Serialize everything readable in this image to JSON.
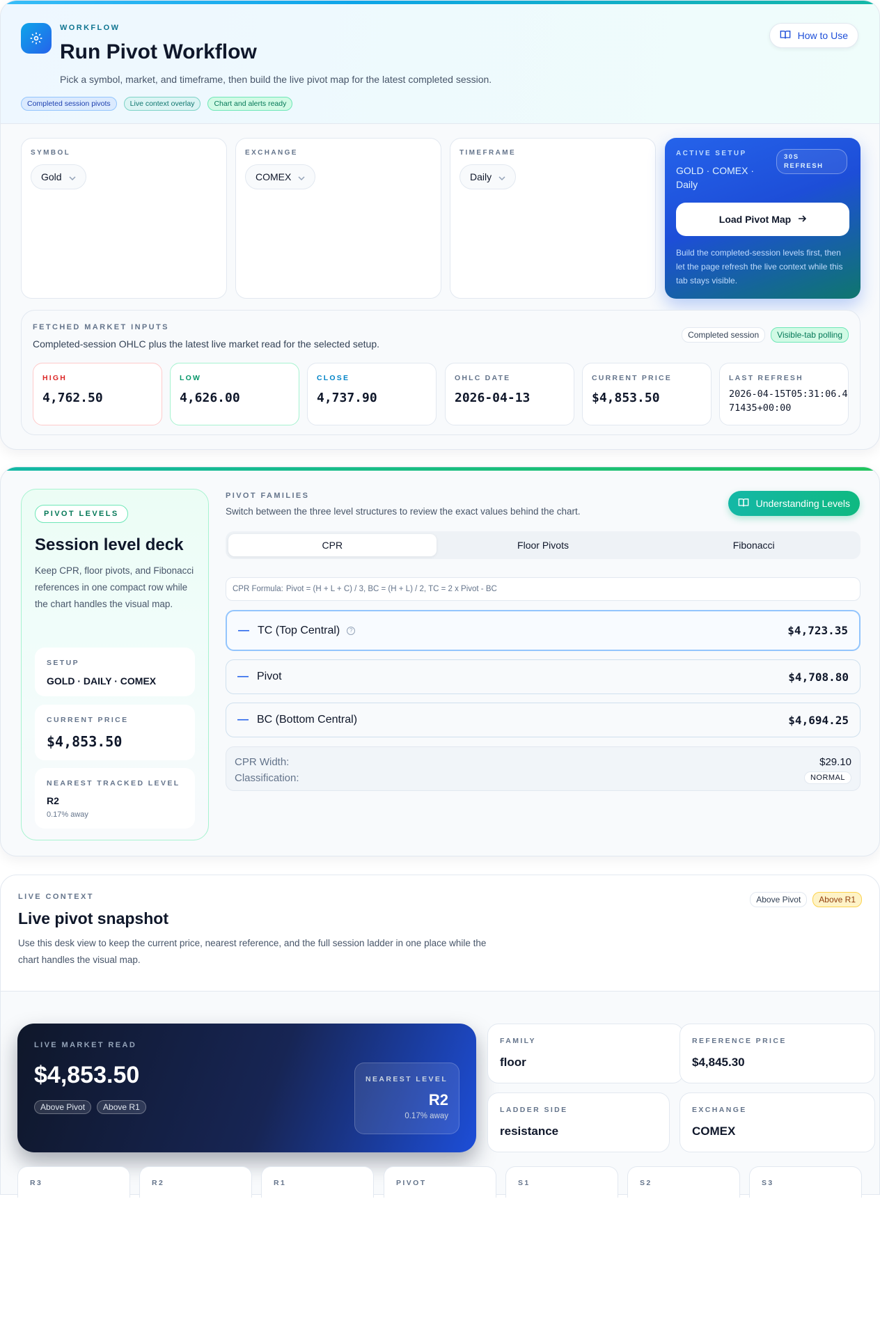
{
  "workflow": {
    "eyebrow": "WORKFLOW",
    "title": "Run Pivot Workflow",
    "subtitle": "Pick a symbol, market, and timeframe, then build the live pivot map for the latest completed session.",
    "chips": [
      "Completed session pivots",
      "Live context overlay",
      "Chart and alerts ready"
    ],
    "how_to_use": "How to Use",
    "gear_icon": "gear-icon",
    "book_icon": "book-icon"
  },
  "selectors": {
    "symbol": {
      "label": "SYMBOL",
      "value": "Gold"
    },
    "exchange": {
      "label": "EXCHANGE",
      "value": "COMEX"
    },
    "timeframe": {
      "label": "TIMEFRAME",
      "value": "Daily"
    }
  },
  "active_setup": {
    "eyebrow": "ACTIVE SETUP",
    "setup": "GOLD · COMEX · Daily",
    "refresh": "30S REFRESH",
    "button": "Load Pivot Map",
    "note": "Build the completed-session levels first, then let the page refresh the live context while this tab stays visible."
  },
  "fetched": {
    "eyebrow": "FETCHED MARKET INPUTS",
    "subtitle": "Completed-session OHLC plus the latest live market read for the selected setup.",
    "chips": [
      "Completed session",
      "Visible-tab polling"
    ],
    "stats": {
      "high": {
        "label": "HIGH",
        "value": "4,762.50"
      },
      "low": {
        "label": "LOW",
        "value": "4,626.00"
      },
      "close": {
        "label": "CLOSE",
        "value": "4,737.90"
      },
      "ohlc_date": {
        "label": "OHLC DATE",
        "value": "2026-04-13"
      },
      "current_price": {
        "label": "CURRENT PRICE",
        "value": "$4,853.50"
      },
      "last_refresh": {
        "label": "LAST REFRESH",
        "value": "2026-04-15T05:31:06.471435+00:00"
      }
    }
  },
  "deck": {
    "pill": "PIVOT LEVELS",
    "title": "Session level deck",
    "description": "Keep CPR, floor pivots, and Fibonacci references in one compact row while the chart handles the visual map.",
    "setup_label": "SETUP",
    "setup_value": "GOLD · DAILY · COMEX",
    "current_label": "CURRENT PRICE",
    "current_value": "$4,853.50",
    "nearest_label": "NEAREST TRACKED LEVEL",
    "nearest_value": "R2",
    "nearest_dist": "0.17% away"
  },
  "families": {
    "eyebrow": "PIVOT FAMILIES",
    "subtitle": "Switch between the three level structures to review the exact values behind the chart.",
    "understanding": "Understanding Levels",
    "tabs": [
      "CPR",
      "Floor Pivots",
      "Fibonacci"
    ],
    "active_tab": "CPR",
    "formula_label": "CPR Formula:",
    "formula": "Pivot = (H + L + C) / 3, BC = (H + L) / 2, TC = 2 x Pivot - BC",
    "levels": [
      {
        "name": "TC (Top Central)",
        "value": "$4,723.35"
      },
      {
        "name": "Pivot",
        "value": "$4,708.80"
      },
      {
        "name": "BC (Bottom Central)",
        "value": "$4,694.25"
      }
    ],
    "cpr_width_label": "CPR Width:",
    "cpr_width": "$29.10",
    "classification_label": "Classification:",
    "classification": "NORMAL"
  },
  "live": {
    "eyebrow": "LIVE CONTEXT",
    "title": "Live pivot snapshot",
    "description": "Use this desk view to keep the current price, nearest reference, and the full session ladder in one place while the chart handles the visual map.",
    "chips": [
      "Above Pivot",
      "Above R1"
    ],
    "market_eyebrow": "LIVE MARKET READ",
    "price": "$4,853.50",
    "market_chips": [
      "Above Pivot",
      "Above R1"
    ],
    "nearest_eyebrow": "NEAREST LEVEL",
    "nearest": "R2",
    "nearest_dist": "0.17% away",
    "family_label": "FAMILY",
    "family": "floor",
    "ref_label": "REFERENCE PRICE",
    "ref": "$4,845.30",
    "side_label": "LADDER SIDE",
    "side": "resistance",
    "exchange_label": "EXCHANGE",
    "exchange": "COMEX",
    "ladder": [
      "R3",
      "R2",
      "R1",
      "PIVOT",
      "S1",
      "S2",
      "S3"
    ]
  }
}
